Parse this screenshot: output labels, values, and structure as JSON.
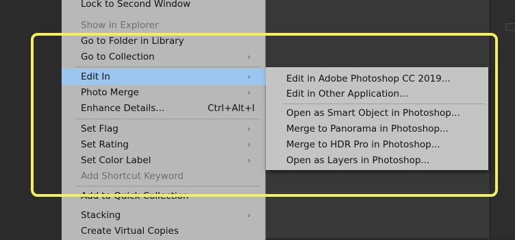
{
  "menu": {
    "items": [
      {
        "label": "Lock to Second Window",
        "disabled": false
      },
      {
        "label": "Show in Explorer",
        "disabled": true
      },
      {
        "label": "Go to Folder in Library",
        "disabled": false
      },
      {
        "label": "Go to Collection",
        "arrow": "›"
      },
      {
        "label": "Edit In",
        "arrow": "›",
        "highlighted": true
      },
      {
        "label": "Photo Merge",
        "arrow": "›"
      },
      {
        "label": "Enhance Details...",
        "shortcut": "Ctrl+Alt+I"
      },
      {
        "label": "Set Flag",
        "arrow": "›"
      },
      {
        "label": "Set Rating",
        "arrow": "›"
      },
      {
        "label": "Set Color Label",
        "arrow": "›"
      },
      {
        "label": "Add Shortcut Keyword",
        "disabled": true
      },
      {
        "label": "Add to Quick Collection"
      },
      {
        "label": "Stacking",
        "arrow": "›"
      },
      {
        "label": "Create Virtual Copies"
      }
    ]
  },
  "submenu": {
    "items": [
      {
        "label": "Edit in Adobe Photoshop CC 2019..."
      },
      {
        "label": "Edit in Other Application..."
      },
      {
        "label": "Open as Smart Object in Photoshop..."
      },
      {
        "label": "Merge to Panorama in Photoshop..."
      },
      {
        "label": "Merge to HDR Pro in Photoshop..."
      },
      {
        "label": "Open as Layers in Photoshop..."
      }
    ]
  },
  "colors": {
    "menu_bg": "#b8b8b8",
    "highlight": "#9cc6ed",
    "annotation_outline": "#f3ef5d"
  }
}
